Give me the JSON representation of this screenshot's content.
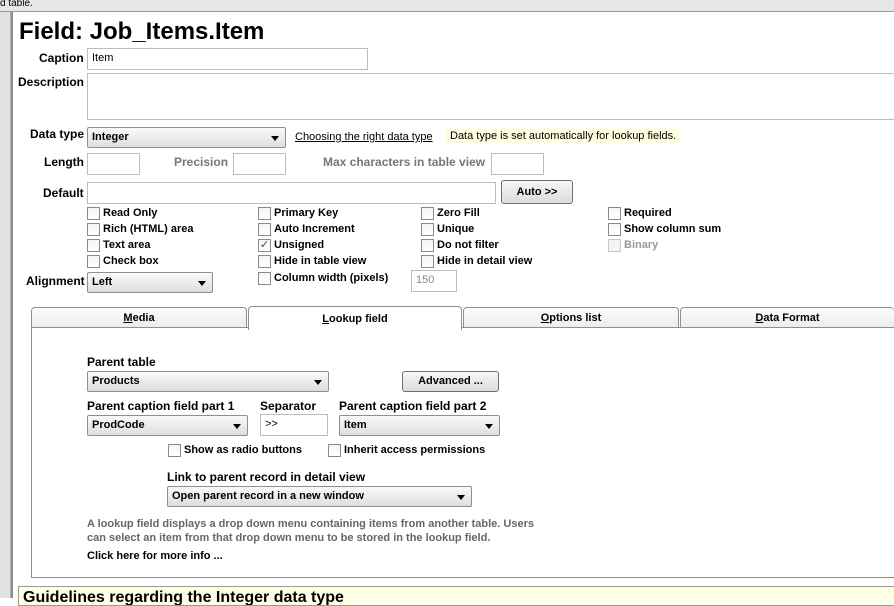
{
  "top_strip": "d table.",
  "title": "Field: Job_Items.Item",
  "caption": {
    "label": "Caption",
    "value": "Item"
  },
  "description": {
    "label": "Description",
    "value": ""
  },
  "data_type": {
    "label": "Data type",
    "value": "Integer",
    "help_link": "Choosing the right data type",
    "note": "Data type is set automatically for lookup fields."
  },
  "length": {
    "label": "Length",
    "value": ""
  },
  "precision": {
    "label": "Precision",
    "value": ""
  },
  "max_chars": {
    "label": "Max characters in table view",
    "value": ""
  },
  "default": {
    "label": "Default",
    "value": "",
    "auto_button": "Auto >>"
  },
  "checkboxes": {
    "read_only": {
      "label": "Read Only",
      "checked": false
    },
    "rich_html": {
      "label": "Rich (HTML) area",
      "checked": false
    },
    "text_area": {
      "label": "Text area",
      "checked": false
    },
    "check_box": {
      "label": "Check box",
      "checked": false
    },
    "primary_key": {
      "label": "Primary Key",
      "checked": false
    },
    "auto_increment": {
      "label": "Auto Increment",
      "checked": false
    },
    "unsigned": {
      "label": "Unsigned",
      "checked": true
    },
    "hide_in_table_view": {
      "label": "Hide in table view",
      "checked": false
    },
    "column_width": {
      "label": "Column width (pixels)",
      "checked": false
    },
    "zero_fill": {
      "label": "Zero Fill",
      "checked": false
    },
    "unique": {
      "label": "Unique",
      "checked": false
    },
    "do_not_filter": {
      "label": "Do not filter",
      "checked": false
    },
    "hide_in_detail_view": {
      "label": "Hide in detail view",
      "checked": false
    },
    "required": {
      "label": "Required",
      "checked": false
    },
    "show_column_sum": {
      "label": "Show column sum",
      "checked": false
    },
    "binary": {
      "label": "Binary",
      "checked": false,
      "disabled": true
    }
  },
  "check_mark": "✓",
  "column_width_value": "150",
  "alignment": {
    "label": "Alignment",
    "value": "Left"
  },
  "tabs": [
    "Media",
    "Lookup field",
    "Options list",
    "Data Format"
  ],
  "tab_access_keys": [
    "M",
    "L",
    "O",
    "D"
  ],
  "tab_rest": [
    "edia",
    "ookup field",
    "ptions list",
    "ata Format"
  ],
  "active_tab": "Lookup field",
  "lookup": {
    "parent_table_label": "Parent table",
    "parent_table_value": "Products",
    "advanced_button": "Advanced ...",
    "caption_part1_label": "Parent caption field part 1",
    "caption_part1_value": "ProdCode",
    "separator_label": "Separator",
    "separator_value": ">>",
    "caption_part2_label": "Parent caption field part 2",
    "caption_part2_value": "Item",
    "radio_buttons_label": "Show as radio buttons",
    "inherit_label": "Inherit access permissions",
    "link_label": "Link to parent record in detail view",
    "link_value": "Open parent record in a new window",
    "help_line1": "A lookup field displays a drop down menu containing items from another table. Users",
    "help_line2": "can select an item from that drop down menu to be stored in the lookup field.",
    "more_info": "Click here for more info ..."
  },
  "guidelines_heading": "Guidelines regarding the Integer data type"
}
